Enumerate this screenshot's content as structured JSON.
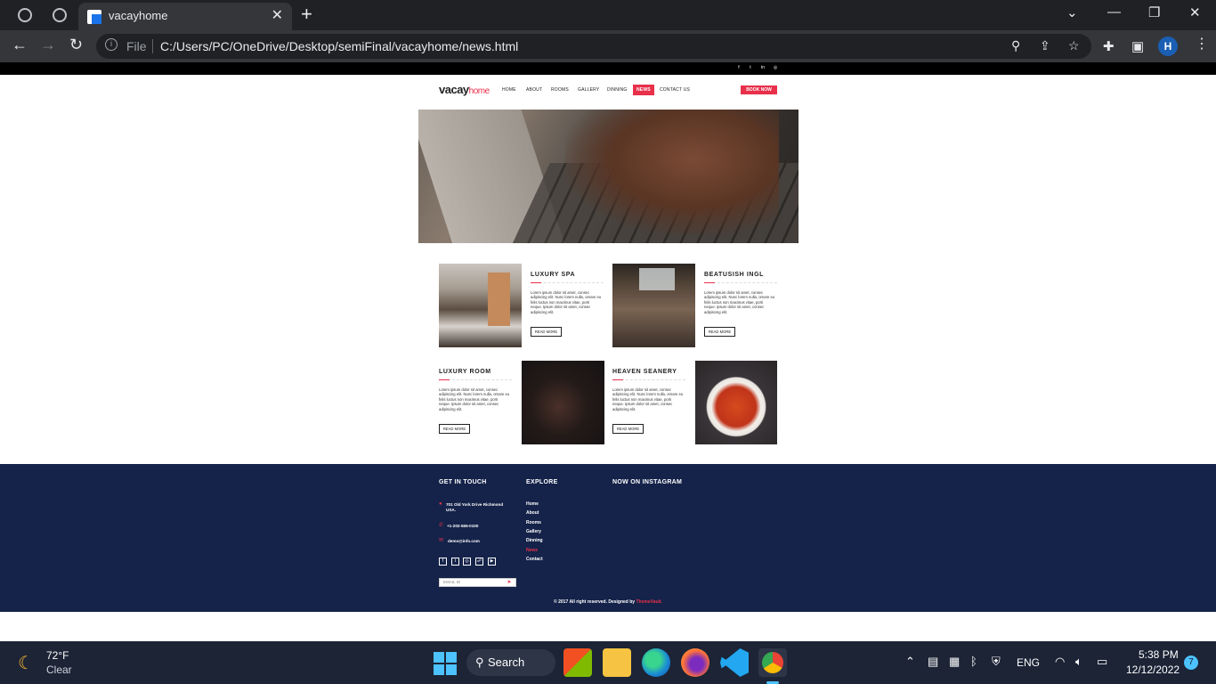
{
  "browser": {
    "tab_title": "vacayhome",
    "omnibox_scheme": "File",
    "url": "C:/Users/PC/OneDrive/Desktop/semiFinal/vacayhome/news.html",
    "profile_initial": "H"
  },
  "site": {
    "logo_main": "vacay",
    "logo_accent": "home",
    "menu": [
      "HOME",
      "ABOUT",
      "ROOMS",
      "GALLERY",
      "DINNING",
      "NEWS",
      "CONTACT US"
    ],
    "active_menu": "NEWS",
    "book_button": "BOOK NOW",
    "accent_color": "#e8304b"
  },
  "cards": [
    {
      "title": "LUXURY SPA",
      "body": "Lorem ipsum dolor sit amet, consec adipiscing elit. Nunc lorem nulla, ornare eu felis luctus non maximus vitae, porti neque. Ipsum dolor sit amet, consec adipiscing elit.",
      "button": "READ MORE"
    },
    {
      "title": "BEATUSISH INGL",
      "body": "Lorem ipsum dolor sit amet, consec adipiscing elit. Nunc lorem nulla, ornare eu felis luctus non maximus vitae, porti neque. Ipsum dolor sit amet, consec adipiscing elit.",
      "button": "READ MORE"
    },
    {
      "title": "LUXURY ROOM",
      "body": "Lorem ipsum dolor sit amet, consec adipiscing elit. Nunc lorem nulla, ornare eu felis luctus non maximus vitae, porti neque. Ipsum dolor sit amet, consec adipiscing elit.",
      "button": "READ MORE"
    },
    {
      "title": "HEAVEN SEANERY",
      "body": "Lorem ipsum dolor sit amet, consec adipiscing elit. Nunc lorem nulla, ornare eu felis luctus non maximus vitae, porti neque. Ipsum dolor sit amet, consec adipiscing elit.",
      "button": "READ MORE"
    }
  ],
  "footer": {
    "get_in_touch": "GET IN TOUCH",
    "address_line1": "701 Old York Drive Richmond",
    "address_line2": "USA.",
    "phone": "+1-202-555-0100",
    "email": "demo@info.com",
    "email_placeholder": "EMAIL ID",
    "explore": "EXPLORE",
    "links": [
      "Home",
      "About",
      "Rooms",
      "Gallery",
      "Dinning",
      "News",
      "Contact"
    ],
    "instagram": "NOW ON INSTAGRAM",
    "copyright": "© 2017 All right reserved. Designed by",
    "designer": "ThemeVault."
  },
  "taskbar": {
    "temperature": "72°F",
    "weather": "Clear",
    "search": "Search",
    "language": "ENG",
    "time": "5:38 PM",
    "date": "12/12/2022",
    "notifications": "7"
  }
}
